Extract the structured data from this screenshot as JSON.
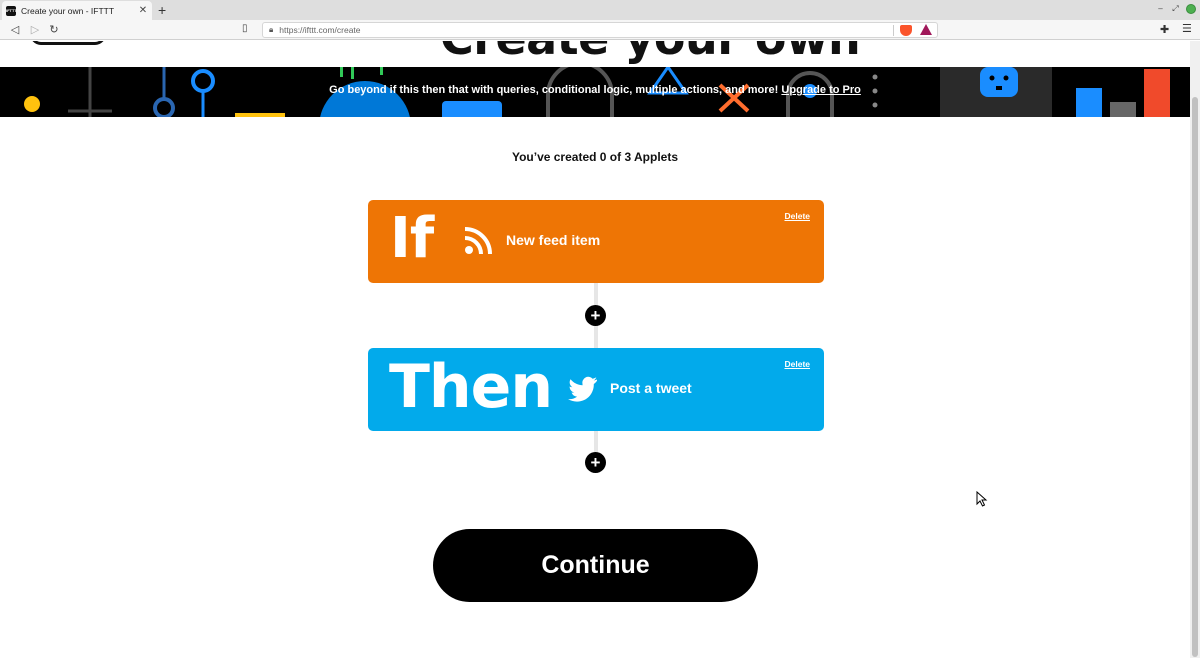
{
  "browser": {
    "tab_title": "Create your own - IFTTT",
    "tab_favicon_text": "IFTTT",
    "new_tab_label": "+",
    "url": "https://ifttt.com/create"
  },
  "page": {
    "heading": "Create your own",
    "banner": {
      "text": "Go beyond if this then that with queries, conditional logic, multiple actions, and more! ",
      "link": "Upgrade to Pro"
    },
    "counter": "You’ve created 0 of 3 Applets",
    "trigger": {
      "keyword": "If",
      "label": "New feed item",
      "icon": "rss-icon",
      "delete_label": "Delete",
      "color": "#ee7505"
    },
    "action": {
      "keyword": "Then",
      "label": "Post a tweet",
      "icon": "twitter-icon",
      "delete_label": "Delete",
      "color": "#02aaeb"
    },
    "add_symbol": "+",
    "continue_label": "Continue"
  }
}
